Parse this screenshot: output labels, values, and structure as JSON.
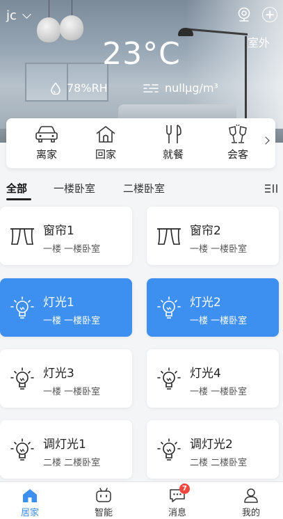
{
  "header": {
    "user_name": "jc",
    "outdoor_label": "室外",
    "temperature": "23°C",
    "humidity": "78%RH",
    "air_quality": "nullμg/m³"
  },
  "scenes": [
    {
      "label": "离家",
      "icon": "car-icon"
    },
    {
      "label": "回家",
      "icon": "home-icon"
    },
    {
      "label": "就餐",
      "icon": "dining-icon"
    },
    {
      "label": "会客",
      "icon": "cheers-icon"
    }
  ],
  "tabs": [
    {
      "label": "全部",
      "active": true
    },
    {
      "label": "一楼卧室",
      "active": false
    },
    {
      "label": "二楼卧室",
      "active": false
    }
  ],
  "devices": [
    {
      "name": "窗帘1",
      "location": "一楼 一楼卧室",
      "type": "curtain",
      "on": false
    },
    {
      "name": "窗帘2",
      "location": "一楼 一楼卧室",
      "type": "curtain",
      "on": false
    },
    {
      "name": "灯光1",
      "location": "一楼 一楼卧室",
      "type": "light",
      "on": true
    },
    {
      "name": "灯光2",
      "location": "一楼 一楼卧室",
      "type": "light",
      "on": true
    },
    {
      "name": "灯光3",
      "location": "一楼 一楼卧室",
      "type": "light",
      "on": false
    },
    {
      "name": "灯光4",
      "location": "一楼 一楼卧室",
      "type": "light",
      "on": false
    },
    {
      "name": "调灯光1",
      "location": "二楼 二楼卧室",
      "type": "light",
      "on": false
    },
    {
      "name": "调灯光2",
      "location": "二楼 二楼卧室",
      "type": "light",
      "on": false
    }
  ],
  "bottom_nav": [
    {
      "label": "居家",
      "icon": "home-icon",
      "active": true
    },
    {
      "label": "智能",
      "icon": "robot-icon",
      "active": false
    },
    {
      "label": "消息",
      "icon": "message-icon",
      "active": false,
      "badge": "7"
    },
    {
      "label": "我的",
      "icon": "user-icon",
      "active": false
    }
  ],
  "colors": {
    "accent": "#3d8ff0",
    "badge": "#f0483e"
  }
}
